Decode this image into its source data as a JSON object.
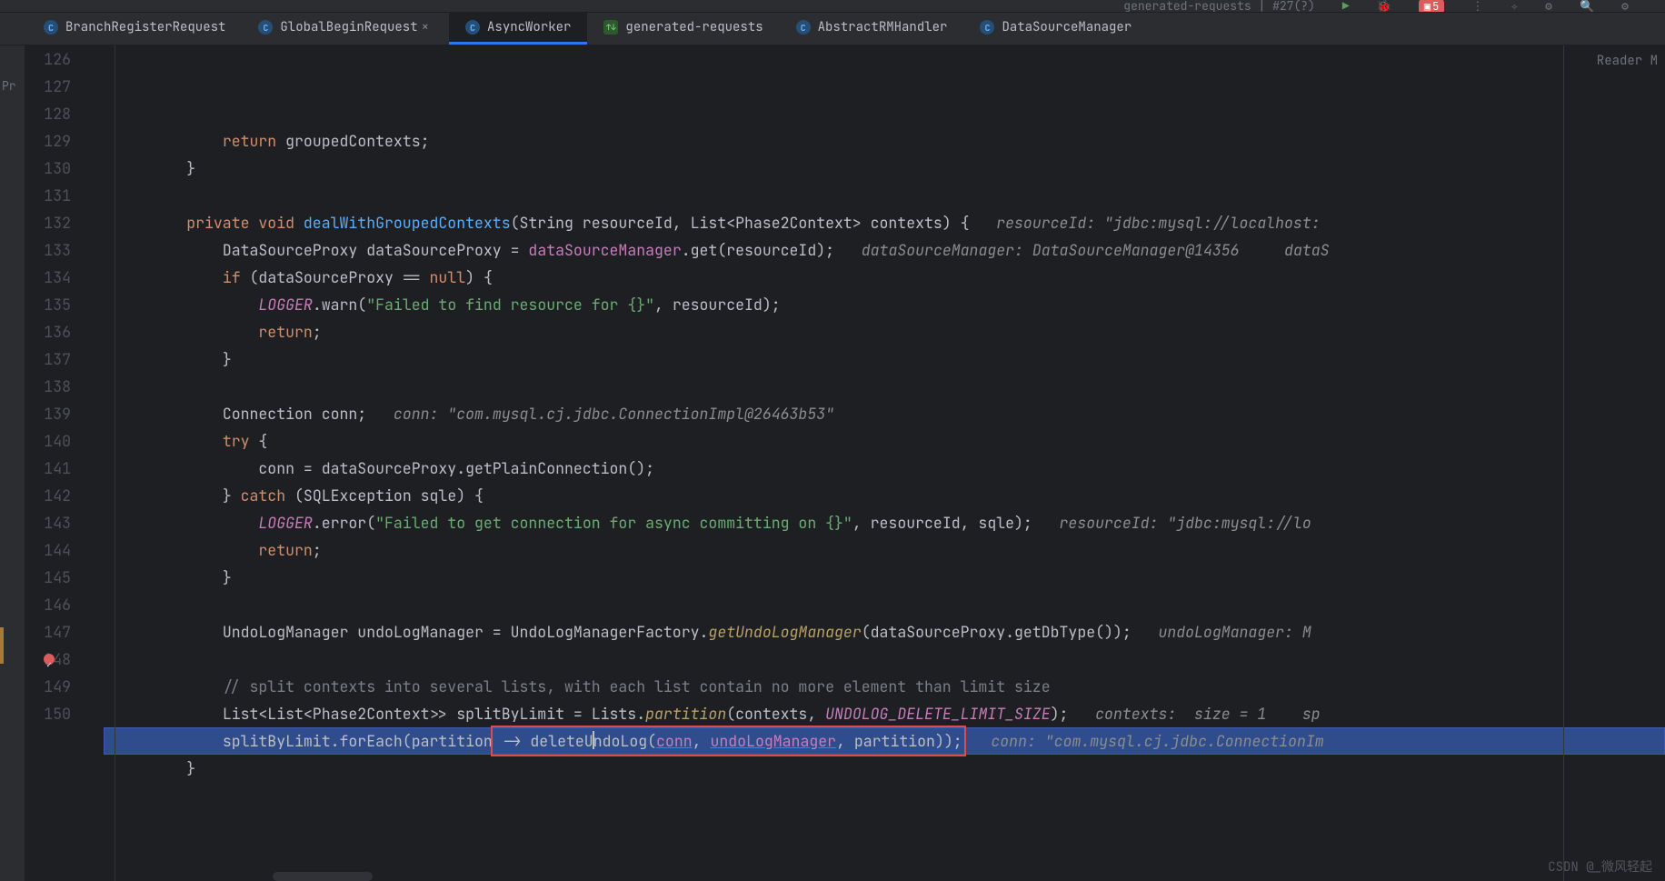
{
  "toolbar": {
    "run_config": "generated-requests | #27(?)",
    "badge": "5"
  },
  "tabs": [
    {
      "label": "BranchRegisterRequest",
      "active": false,
      "icon": "C"
    },
    {
      "label": "GlobalBeginRequest",
      "active": false,
      "icon": "C"
    },
    {
      "label": "AsyncWorker",
      "active": true,
      "icon": "C"
    },
    {
      "label": "generated-requests",
      "active": false,
      "icon": "http"
    },
    {
      "label": "AbstractRMHandler",
      "active": false,
      "icon": "C"
    },
    {
      "label": "DataSourceManager",
      "active": false,
      "icon": "C"
    }
  ],
  "reader_mode_label": "Reader M",
  "left_strip_label": "Pr",
  "gutter": {
    "start": 126,
    "end": 150,
    "breakpoint_line": 148,
    "current_line": 148
  },
  "code_lines": {
    "126": {
      "indent": 12,
      "tokens": [
        [
          "kw",
          "return"
        ],
        [
          "punc",
          " "
        ],
        [
          "var",
          "groupedContexts"
        ],
        [
          "punc",
          ";"
        ]
      ]
    },
    "127": {
      "indent": 8,
      "tokens": [
        [
          "punc",
          "}"
        ]
      ]
    },
    "128": {
      "indent": 0,
      "tokens": []
    },
    "129": {
      "indent": 8,
      "tokens": [
        [
          "kw",
          "private void "
        ],
        [
          "mname",
          "dealWithGroupedContexts"
        ],
        [
          "punc",
          "(String resourceId, List<Phase2Context> contexts) {"
        ]
      ],
      "hint": "resourceId: \"jdbc:mysql://localhost:"
    },
    "130": {
      "indent": 12,
      "tokens": [
        [
          "type",
          "DataSourceProxy dataSourceProxy = "
        ],
        [
          "fld",
          "dataSourceManager"
        ],
        [
          "punc",
          ".get(resourceId);"
        ]
      ],
      "hint": "dataSourceManager: DataSourceManager@14356     dataS"
    },
    "131": {
      "indent": 12,
      "tokens": [
        [
          "kw",
          "if"
        ],
        [
          "punc",
          " (dataSourceProxy == "
        ],
        [
          "kw",
          "null"
        ],
        [
          "punc",
          ") {"
        ]
      ]
    },
    "132": {
      "indent": 16,
      "tokens": [
        [
          "ifld",
          "LOGGER"
        ],
        [
          "punc",
          ".warn("
        ],
        [
          "str",
          "\"Failed to find resource for {}\""
        ],
        [
          "punc",
          ", resourceId);"
        ]
      ]
    },
    "133": {
      "indent": 16,
      "tokens": [
        [
          "kw",
          "return"
        ],
        [
          "punc",
          ";"
        ]
      ]
    },
    "134": {
      "indent": 12,
      "tokens": [
        [
          "punc",
          "}"
        ]
      ]
    },
    "135": {
      "indent": 0,
      "tokens": []
    },
    "136": {
      "indent": 12,
      "tokens": [
        [
          "type",
          "Connection conn;"
        ]
      ],
      "hint": "conn: \"com.mysql.cj.jdbc.ConnectionImpl@26463b53\""
    },
    "137": {
      "indent": 12,
      "tokens": [
        [
          "kw",
          "try"
        ],
        [
          "punc",
          " {"
        ]
      ]
    },
    "138": {
      "indent": 16,
      "tokens": [
        [
          "var",
          "conn = dataSourceProxy.getPlainConnection();"
        ]
      ]
    },
    "139": {
      "indent": 12,
      "tokens": [
        [
          "punc",
          "} "
        ],
        [
          "kw",
          "catch"
        ],
        [
          "punc",
          " (SQLException sqle) {"
        ]
      ]
    },
    "140": {
      "indent": 16,
      "tokens": [
        [
          "ifld",
          "LOGGER"
        ],
        [
          "punc",
          ".error("
        ],
        [
          "str",
          "\"Failed to get connection for async committing on {}\""
        ],
        [
          "punc",
          ", resourceId, sqle);"
        ]
      ],
      "hint": "resourceId: \"jdbc:mysql://lo"
    },
    "141": {
      "indent": 16,
      "tokens": [
        [
          "kw",
          "return"
        ],
        [
          "punc",
          ";"
        ]
      ]
    },
    "142": {
      "indent": 12,
      "tokens": [
        [
          "punc",
          "}"
        ]
      ]
    },
    "143": {
      "indent": 0,
      "tokens": []
    },
    "144": {
      "indent": 12,
      "tokens": [
        [
          "type",
          "UndoLogManager undoLogManager = UndoLogManagerFactory."
        ],
        [
          "imeth",
          "getUndoLogManager"
        ],
        [
          "punc",
          "(dataSourceProxy.getDbType());"
        ]
      ],
      "hint": "undoLogManager: M"
    },
    "145": {
      "indent": 0,
      "tokens": []
    },
    "146": {
      "indent": 12,
      "tokens": [
        [
          "cmt",
          "// split contexts into several lists, with each list contain no more element than limit size"
        ]
      ]
    },
    "147": {
      "indent": 12,
      "tokens": [
        [
          "type",
          "List<List<Phase2Context>> splitByLimit = Lists."
        ],
        [
          "imeth",
          "partition"
        ],
        [
          "punc",
          "(contexts, "
        ],
        [
          "const",
          "UNDOLOG_DELETE_LIMIT_SIZE"
        ],
        [
          "punc",
          ");"
        ]
      ],
      "hint": "contexts:  size = 1    sp"
    },
    "148": {
      "indent": 12,
      "current": true,
      "boxed": true,
      "pre": "splitByLimit.forEach(partition",
      "box_open": " -> deleteU",
      "box_caret": true,
      "box_rest": "ndoLog(",
      "ul1": "conn",
      "mid1": ", ",
      "ul2": "undoLogManager",
      "mid2": ", partition));",
      "hint": "conn: \"com.mysql.cj.jdbc.ConnectionIm"
    },
    "149": {
      "indent": 8,
      "tokens": [
        [
          "punc",
          "}"
        ]
      ]
    },
    "150": {
      "indent": 0,
      "tokens": []
    }
  },
  "watermark": "CSDN @_微风轻起"
}
